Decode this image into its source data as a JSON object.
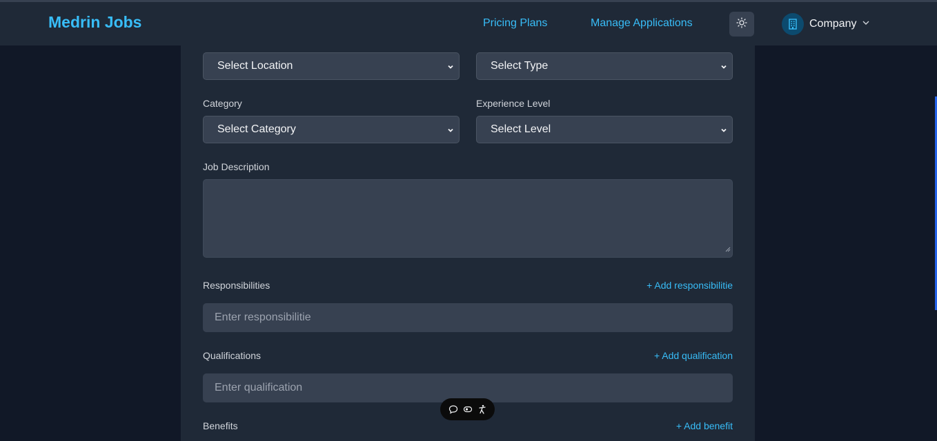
{
  "nav": {
    "brand": "Medrin Jobs",
    "pricing": "Pricing Plans",
    "manage": "Manage Applications",
    "company": "Company"
  },
  "form": {
    "location_select": "Select Location",
    "type_select": "Select Type",
    "category_label": "Category",
    "category_select": "Select Category",
    "experience_label": "Experience Level",
    "experience_select": "Select Level",
    "description_label": "Job Description",
    "responsibilities_label": "Responsibilities",
    "responsibilities_add": "+ Add responsibilitie",
    "responsibilities_placeholder": "Enter responsibilitie",
    "qualifications_label": "Qualifications",
    "qualifications_add": "+ Add qualification",
    "qualifications_placeholder": "Enter qualification",
    "benefits_label": "Benefits",
    "benefits_add": "+ Add benefit"
  },
  "colors": {
    "accent": "#38bdf8",
    "background": "#111827",
    "panel": "#1f2937",
    "field": "#374151"
  },
  "icons": [
    "sun-icon",
    "building-icon",
    "chevron-down-icon",
    "chat-icon",
    "eye-icon",
    "accessibility-icon"
  ]
}
